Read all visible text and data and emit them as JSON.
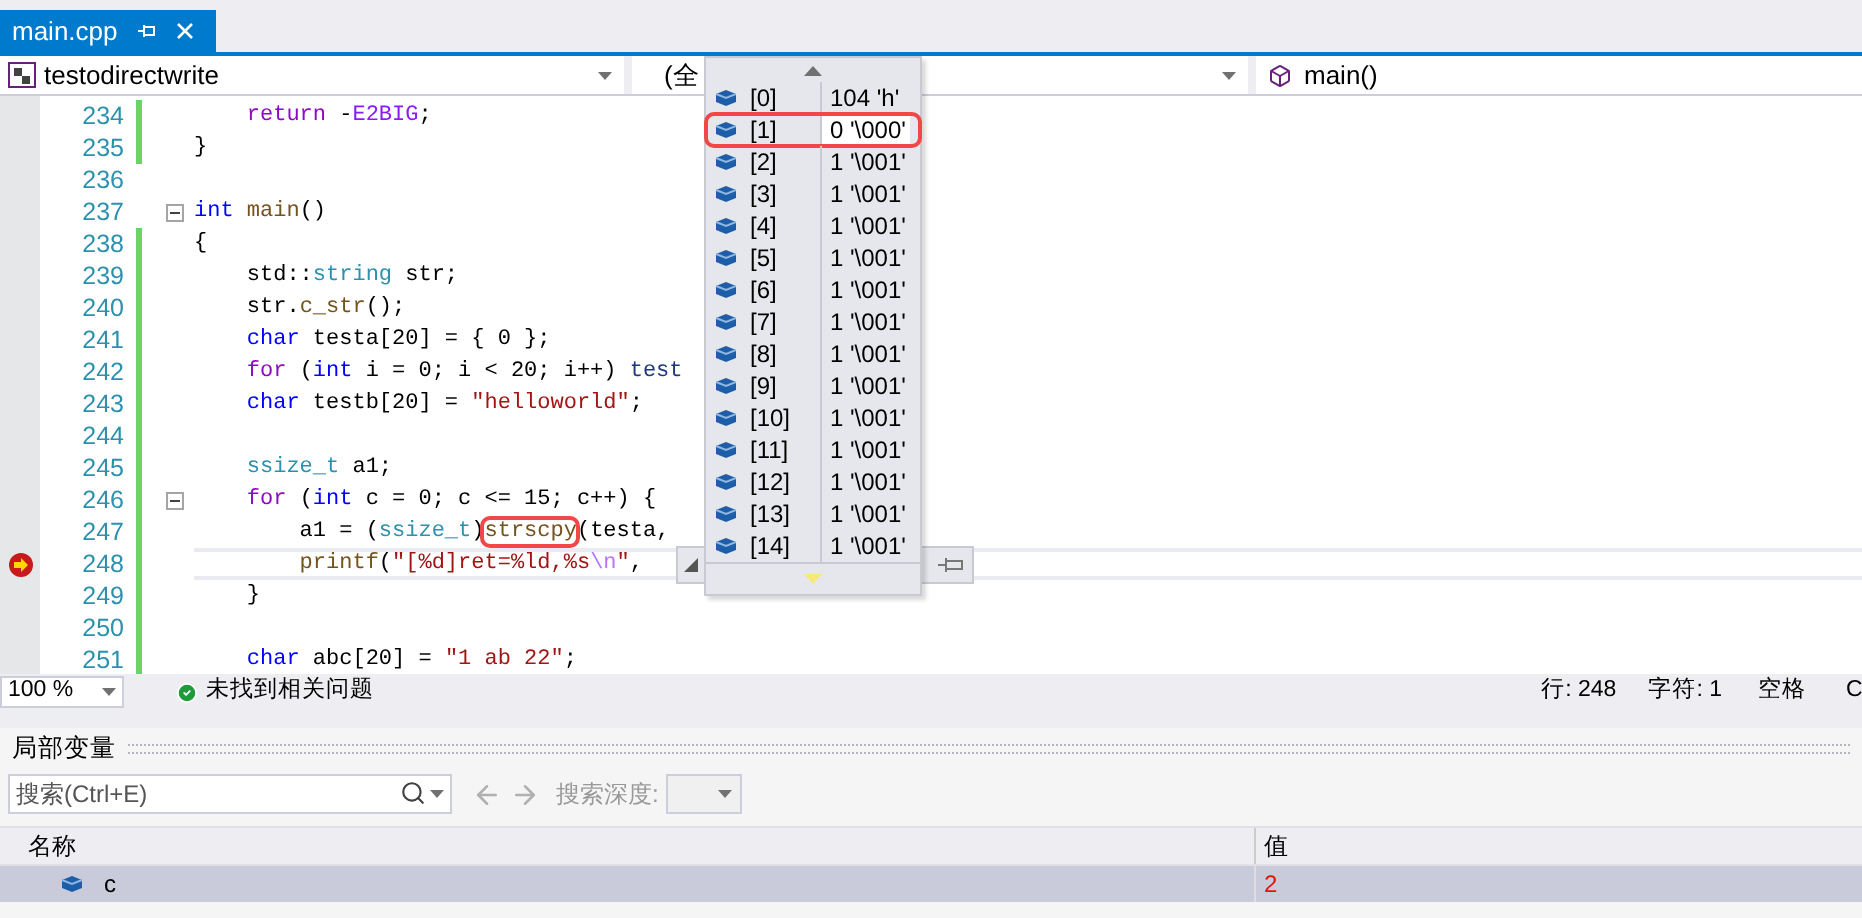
{
  "tab": {
    "title": "main.cpp",
    "selected": true
  },
  "navigation": {
    "project": "testodirectwrite",
    "scope": "(全",
    "member": "main()"
  },
  "code_lines": [
    {
      "number": "234",
      "changed": true,
      "fold": false,
      "breakpoint": false,
      "tokens": [
        {
          "text": "    return",
          "kind": "control"
        },
        {
          "text": " -",
          "kind": "plain"
        },
        {
          "text": "E2BIG",
          "kind": "macro"
        },
        {
          "text": ";",
          "kind": "plain"
        }
      ]
    },
    {
      "number": "235",
      "changed": true,
      "fold": false,
      "breakpoint": false,
      "tokens": [
        {
          "text": "}",
          "kind": "plain"
        }
      ]
    },
    {
      "number": "236",
      "changed": false,
      "fold": false,
      "breakpoint": false
    },
    {
      "number": "237",
      "changed": false,
      "fold": true,
      "breakpoint": false,
      "tokens": [
        {
          "text": "int",
          "kind": "keyword"
        },
        {
          "text": " main",
          "kind": "function"
        },
        {
          "text": "()",
          "kind": "plain"
        }
      ]
    },
    {
      "number": "238",
      "changed": true,
      "fold": false,
      "breakpoint": false,
      "tokens": [
        {
          "text": "{",
          "kind": "plain"
        }
      ]
    },
    {
      "number": "239",
      "changed": true,
      "fold": false,
      "breakpoint": false,
      "tokens": [
        {
          "text": "    std::",
          "kind": "plain"
        },
        {
          "text": "string",
          "kind": "type"
        },
        {
          "text": " str;",
          "kind": "plain"
        }
      ]
    },
    {
      "number": "240",
      "changed": true,
      "fold": false,
      "breakpoint": false,
      "tokens": [
        {
          "text": "    str.",
          "kind": "plain"
        },
        {
          "text": "c_str",
          "kind": "function"
        },
        {
          "text": "();",
          "kind": "plain"
        }
      ]
    },
    {
      "number": "241",
      "changed": true,
      "fold": false,
      "breakpoint": false,
      "tokens": [
        {
          "text": "    char",
          "kind": "keyword"
        },
        {
          "text": " testa[20] = { 0 };",
          "kind": "plain"
        }
      ]
    },
    {
      "number": "242",
      "changed": true,
      "fold": false,
      "breakpoint": false,
      "tokens": [
        {
          "text": "    for",
          "kind": "control"
        },
        {
          "text": " (",
          "kind": "plain"
        },
        {
          "text": "int",
          "kind": "keyword"
        },
        {
          "text": " i = 0; i < 20; i++) ",
          "kind": "plain"
        },
        {
          "text": "test",
          "kind": "variable"
        }
      ]
    },
    {
      "number": "243",
      "changed": true,
      "fold": false,
      "breakpoint": false,
      "tokens": [
        {
          "text": "    char",
          "kind": "keyword"
        },
        {
          "text": " testb[20] = ",
          "kind": "plain"
        },
        {
          "text": "\"helloworld\"",
          "kind": "string"
        },
        {
          "text": ";",
          "kind": "plain"
        }
      ]
    },
    {
      "number": "244",
      "changed": true,
      "fold": false,
      "breakpoint": false
    },
    {
      "number": "245",
      "changed": true,
      "fold": false,
      "breakpoint": false,
      "tokens": [
        {
          "text": "    ssize_t",
          "kind": "type"
        },
        {
          "text": " a1;",
          "kind": "plain"
        }
      ]
    },
    {
      "number": "246",
      "changed": true,
      "fold": true,
      "breakpoint": false,
      "tokens": [
        {
          "text": "    for",
          "kind": "control"
        },
        {
          "text": " (",
          "kind": "plain"
        },
        {
          "text": "int",
          "kind": "keyword"
        },
        {
          "text": " c = 0; c <= 15; c++) {",
          "kind": "plain"
        }
      ]
    },
    {
      "number": "247",
      "changed": true,
      "fold": false,
      "breakpoint": false,
      "tokens": [
        {
          "text": "        a1 = (",
          "kind": "plain"
        },
        {
          "text": "ssize_t",
          "kind": "type"
        },
        {
          "text": ")",
          "kind": "plain"
        },
        {
          "text": "strscpy",
          "kind": "function",
          "circled": true
        },
        {
          "text": "(testa,",
          "kind": "plain"
        }
      ]
    },
    {
      "number": "248",
      "changed": true,
      "fold": false,
      "breakpoint": true,
      "tokens": [
        {
          "text": "        printf",
          "kind": "function"
        },
        {
          "text": "(",
          "kind": "plain"
        },
        {
          "text": "\"[%d]ret=%ld,%s",
          "kind": "string"
        },
        {
          "text": "\\n",
          "kind": "escape"
        },
        {
          "text": "\"",
          "kind": "string"
        },
        {
          "text": ",",
          "kind": "plain"
        }
      ]
    },
    {
      "number": "249",
      "changed": true,
      "fold": false,
      "breakpoint": false,
      "tokens": [
        {
          "text": "    }",
          "kind": "plain"
        }
      ]
    },
    {
      "number": "250",
      "changed": true,
      "fold": false,
      "breakpoint": false
    },
    {
      "number": "251",
      "changed": true,
      "fold": false,
      "breakpoint": false,
      "tokens": [
        {
          "text": "    char",
          "kind": "keyword"
        },
        {
          "text": " abc[20] = ",
          "kind": "plain"
        },
        {
          "text": "\"1 ab 22\"",
          "kind": "string"
        },
        {
          "text": ";",
          "kind": "plain"
        }
      ]
    }
  ],
  "data_tip": {
    "rows": [
      {
        "index": "[0]",
        "value": "104 'h'",
        "selected": false,
        "circled": false
      },
      {
        "index": "[1]",
        "value": "0 '\\000'",
        "selected": true,
        "circled": true
      },
      {
        "index": "[2]",
        "value": "1 '\\001'",
        "selected": false,
        "circled": false
      },
      {
        "index": "[3]",
        "value": "1 '\\001'",
        "selected": false,
        "circled": false
      },
      {
        "index": "[4]",
        "value": "1 '\\001'",
        "selected": false,
        "circled": false
      },
      {
        "index": "[5]",
        "value": "1 '\\001'",
        "selected": false,
        "circled": false
      },
      {
        "index": "[6]",
        "value": "1 '\\001'",
        "selected": false,
        "circled": false
      },
      {
        "index": "[7]",
        "value": "1 '\\001'",
        "selected": false,
        "circled": false
      },
      {
        "index": "[8]",
        "value": "1 '\\001'",
        "selected": false,
        "circled": false
      },
      {
        "index": "[9]",
        "value": "1 '\\001'",
        "selected": false,
        "circled": false
      },
      {
        "index": "[10]",
        "value": "1 '\\001'",
        "selected": false,
        "circled": false
      },
      {
        "index": "[11]",
        "value": "1 '\\001'",
        "selected": false,
        "circled": false
      },
      {
        "index": "[12]",
        "value": "1 '\\001'",
        "selected": false,
        "circled": false
      },
      {
        "index": "[13]",
        "value": "1 '\\001'",
        "selected": false,
        "circled": false
      },
      {
        "index": "[14]",
        "value": "1 '\\001'",
        "selected": false,
        "circled": false
      }
    ]
  },
  "status_bar": {
    "zoom": "100 %",
    "issues": "未找到相关问题",
    "line": "行: 248",
    "column": "字符: 1",
    "spacing": "空格",
    "line_ending": "C"
  },
  "locals": {
    "title": "局部变量",
    "search": {
      "placeholder": "搜索(Ctrl+E)"
    },
    "depth_label": "搜索深度:",
    "columns": [
      "名称",
      "值"
    ],
    "rows": [
      {
        "name": "c",
        "value": "2",
        "selected": true,
        "changed": true
      }
    ]
  }
}
